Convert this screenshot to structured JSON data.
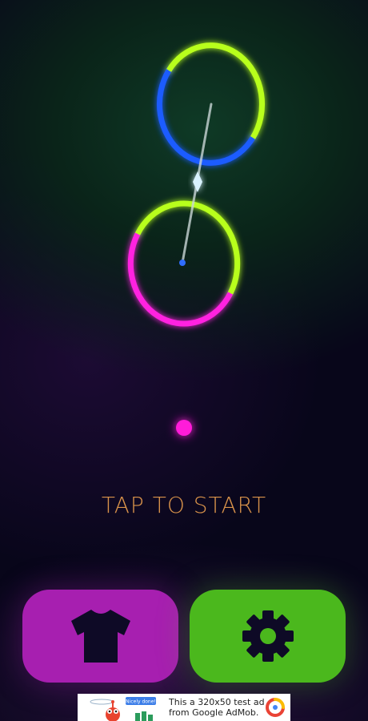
{
  "game": {
    "prompt_text": "TAP TO START",
    "player_color": "#ff1ad9",
    "colors": {
      "green": "#b8ff1f",
      "blue": "#1a5cff",
      "magenta": "#ff22e0",
      "needle": "#c9d6d6",
      "diamond": "#d9f2ff",
      "dot": "#2f6dff"
    }
  },
  "buttons": {
    "skins_icon": "t-shirt-icon",
    "settings_icon": "gear-icon",
    "skins_color": "#a71fb0",
    "settings_color": "#4bb81d"
  },
  "ad": {
    "line1": "This a 320x50 test ad",
    "line2": "from Google AdMob.",
    "badge": "Nicely done!"
  }
}
